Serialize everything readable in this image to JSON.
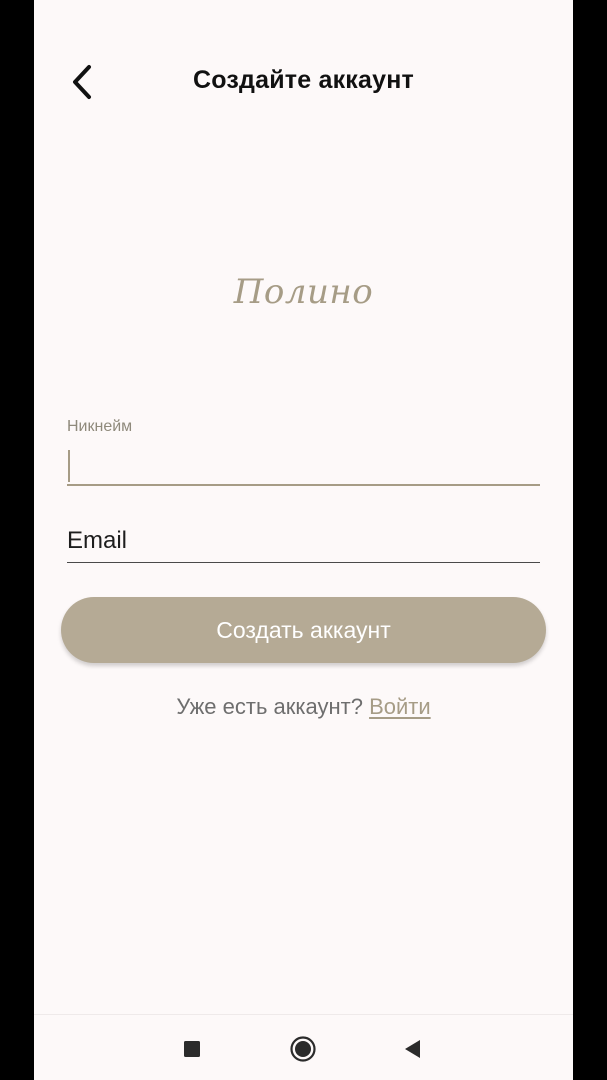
{
  "header": {
    "title": "Создайте аккаунт",
    "back_icon": "chevron-left-icon"
  },
  "logo": {
    "text": "Полино"
  },
  "form": {
    "nickname": {
      "label": "Никнейм",
      "value": ""
    },
    "email": {
      "placeholder": "Email",
      "value": ""
    },
    "submit_label": "Создать аккаунт"
  },
  "login": {
    "prompt": "Уже есть аккаунт?",
    "link_label": "Войти"
  },
  "system_nav": {
    "recents_icon": "square-icon",
    "home_icon": "circle-icon",
    "back_icon": "triangle-left-icon"
  },
  "colors": {
    "background": "#FDF9F9",
    "accent": "#A69C86",
    "button": "#B5AA95",
    "text": "#111111"
  }
}
